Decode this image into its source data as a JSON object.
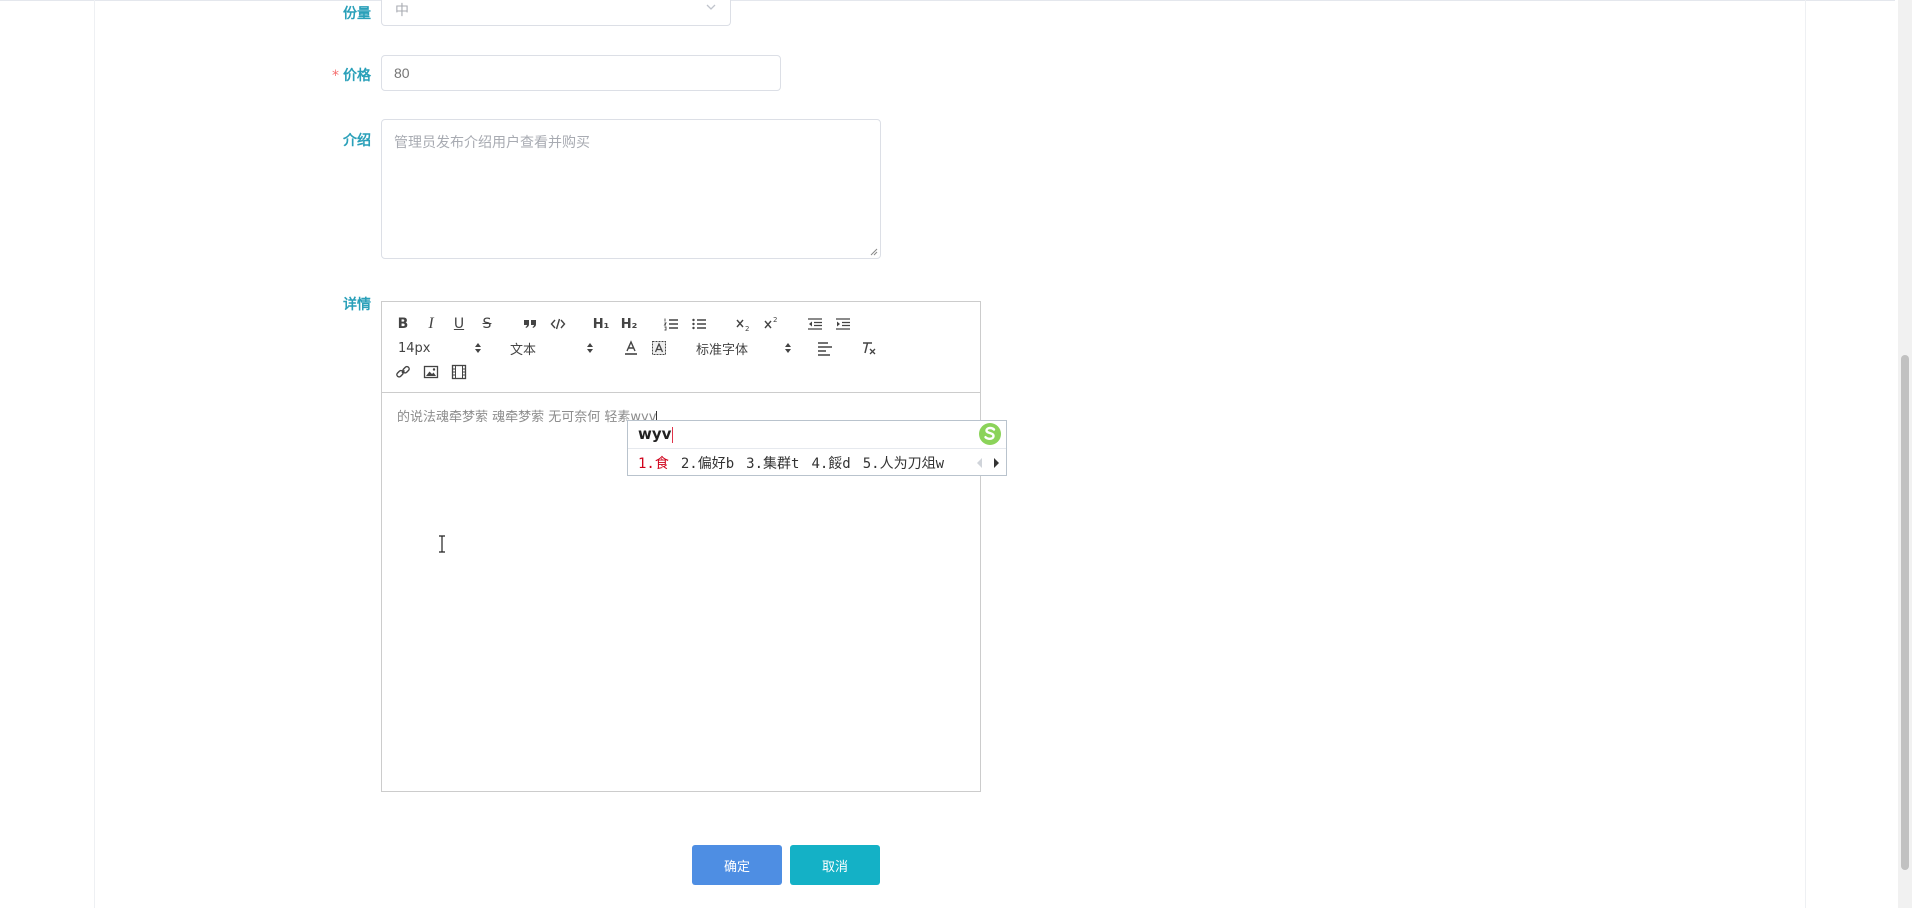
{
  "form": {
    "portion": {
      "label": "份量",
      "value": "中"
    },
    "price": {
      "required_mark": "*",
      "label": "价格",
      "placeholder": "80"
    },
    "intro": {
      "label": "介绍",
      "placeholder": "管理员发布介绍用户查看并购买"
    },
    "detail": {
      "label": "详情"
    }
  },
  "editor": {
    "toolbar": {
      "bold": "B",
      "italic": "I",
      "underline": "U",
      "strike": "S",
      "h1": "H₁",
      "h2": "H₂",
      "size_picker": "14px",
      "header_picker": "文本",
      "font_picker": "标准字体"
    },
    "content_text": "的说法魂牵梦萦 魂牵梦萦 无可奈何 轻素wyv"
  },
  "ime": {
    "composition": "wyv",
    "candidates": [
      "1.食",
      "2.偏好b",
      "3.集群t",
      "4.餒d",
      "5.人为刀俎w"
    ]
  },
  "actions": {
    "confirm": "确定",
    "cancel": "取消"
  },
  "colors": {
    "label": "#2aa0b9",
    "primary": "#4e8ee3",
    "cancel": "#14b1c6",
    "required": "#f56c6c"
  }
}
